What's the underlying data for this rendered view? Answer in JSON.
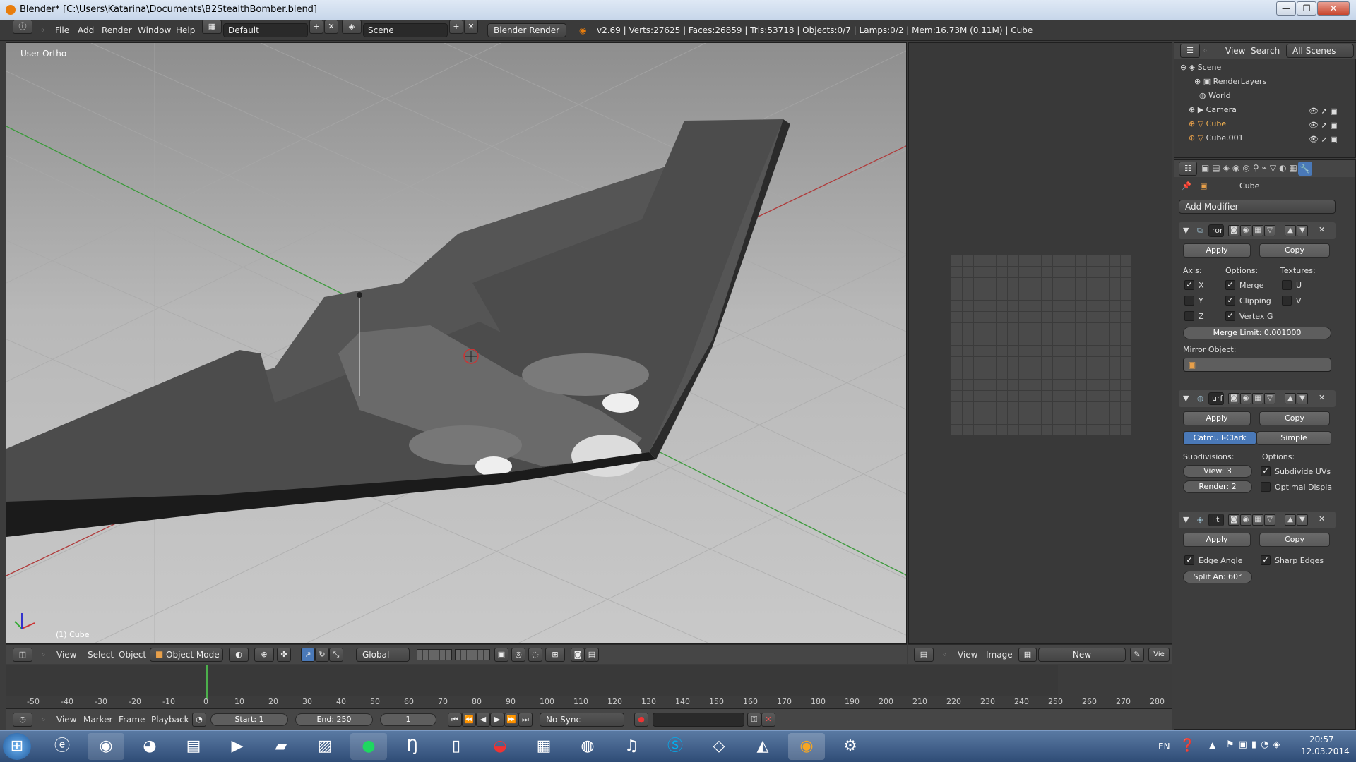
{
  "window": {
    "title": "Blender* [C:\\Users\\Katarina\\Documents\\B2StealthBomber.blend]",
    "minimize": "—",
    "maximize": "❐",
    "close": "✕"
  },
  "info_header": {
    "menus": [
      "File",
      "Add",
      "Render",
      "Window",
      "Help"
    ],
    "screen_layout": "Default",
    "scene": "Scene",
    "render_engine": "Blender Render",
    "stats": "v2.69 | Verts:27625 | Faces:26859 | Tris:53718 | Objects:0/7 | Lamps:0/2 | Mem:16.73M (0.11M) | Cube"
  },
  "viewport": {
    "view_label": "User Ortho",
    "object_label": "(1) Cube",
    "header": {
      "view": "View",
      "select": "Select",
      "object": "Object",
      "mode": "Object Mode",
      "orientation": "Global"
    }
  },
  "image_editor": {
    "header": {
      "view": "View",
      "image": "Image",
      "new": "New",
      "vie": "Vie"
    }
  },
  "timeline": {
    "ticks": [
      "-50",
      "-40",
      "-30",
      "-20",
      "-10",
      "0",
      "10",
      "20",
      "30",
      "40",
      "50",
      "60",
      "70",
      "80",
      "90",
      "100",
      "110",
      "120",
      "130",
      "140",
      "150",
      "160",
      "170",
      "180",
      "190",
      "200",
      "210",
      "220",
      "230",
      "240",
      "250",
      "260",
      "270",
      "280"
    ],
    "header": {
      "view": "View",
      "marker": "Marker",
      "frame": "Frame",
      "playback": "Playback",
      "start": "Start: 1",
      "end": "End: 250",
      "current": "1",
      "sync": "No Sync"
    }
  },
  "outliner": {
    "menu_view": "View",
    "menu_search": "Search",
    "filter": "All Scenes",
    "items": [
      {
        "label": "Scene"
      },
      {
        "label": "RenderLayers"
      },
      {
        "label": "World"
      },
      {
        "label": "Camera"
      },
      {
        "label": "Cube"
      },
      {
        "label": "Cube.001"
      }
    ]
  },
  "properties": {
    "object_name": "Cube",
    "add_modifier": "Add Modifier",
    "mirror": {
      "name": "ror",
      "apply": "Apply",
      "copy": "Copy",
      "axis_label": "Axis:",
      "options_label": "Options:",
      "textures_label": "Textures:",
      "x": "X",
      "y": "Y",
      "z": "Z",
      "merge": "Merge",
      "clipping": "Clipping",
      "vertex_g": "Vertex G",
      "u": "U",
      "v": "V",
      "merge_limit": "Merge Limit: 0.001000",
      "mirror_object": "Mirror Object:"
    },
    "subsurf": {
      "name": "urf",
      "apply": "Apply",
      "copy": "Copy",
      "catmull": "Catmull-Clark",
      "simple": "Simple",
      "subdivisions": "Subdivisions:",
      "options": "Options:",
      "view": "View: 3",
      "render": "Render: 2",
      "subdivide_uvs": "Subdivide UVs",
      "optimal": "Optimal Displa"
    },
    "edgesplit": {
      "name": "lit",
      "apply": "Apply",
      "copy": "Copy",
      "edge_angle": "Edge Angle",
      "sharp_edges": "Sharp Edges",
      "split_angle": "Split An: 60°"
    }
  },
  "taskbar": {
    "lang": "EN",
    "time": "20:57",
    "date": "12.03.2014"
  },
  "colors": {
    "accent": "#4a79b8",
    "blender_orange": "#e87d0d",
    "current_frame": "#4cb04c"
  }
}
